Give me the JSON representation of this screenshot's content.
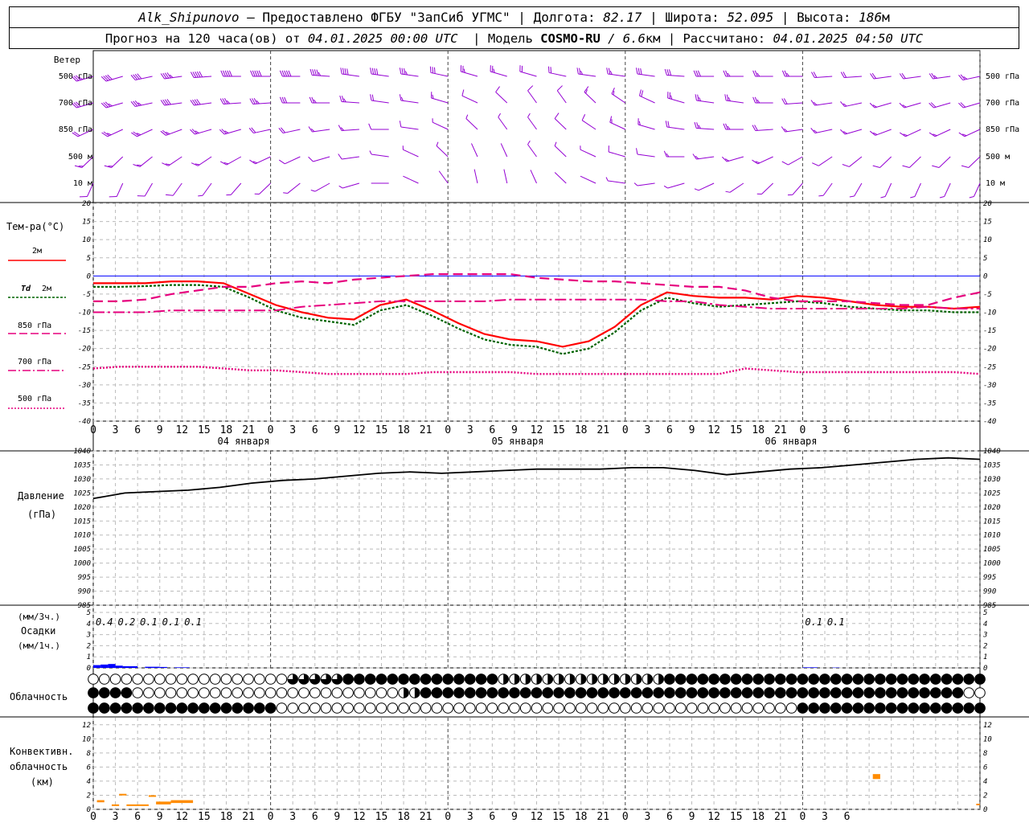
{
  "header": {
    "station": "Alk_Shipunovo",
    "provider": " – Предоставлено ФГБУ \"ЗапСиб УГМС\" | Долгота: ",
    "lon": "82.17",
    "lat_label": " | Широта: ",
    "lat": "52.095",
    "alt_label": " | Высота: ",
    "alt": "186",
    "alt_unit": "м",
    "forecast_prefix": "Прогноз на 120 часа(ов) от ",
    "forecast_start": "04.01.2025 00:00 UTC",
    "model_label": "  | Модель ",
    "model_name": "COSMO-RU",
    "model_res": " / 6.6",
    "model_res_unit": "км",
    "calc_label": " | Рассчитано: ",
    "calc_time": "04.01.2025 04:50 UTC"
  },
  "labels": {
    "wind": "Ветер",
    "wind_levels": [
      "500 гПа",
      "700 гПа",
      "850 гПа",
      "500 м",
      "10 м"
    ],
    "temp": "Тем-ра(°C)",
    "leg_2m": "2м",
    "leg_td": "Td",
    "leg_td2": "2м",
    "leg_850": "850 гПа",
    "leg_700": "700 гПа",
    "leg_500": "500 гПа",
    "pressure1": "Давление",
    "pressure2": "(гПа)",
    "precip1": "(мм/3ч.)",
    "precip2": "Осадки",
    "precip3": "(мм/1ч.)",
    "cloud": "Облачность",
    "conv1": "Конвективн.",
    "conv2": "облачность",
    "conv3": "(км)",
    "days": [
      "04 января",
      "05 января",
      "06 января"
    ]
  },
  "colors": {
    "wind": "#9400d3",
    "t2m": "#ff0000",
    "td2m": "#006400",
    "t850": "#e6007e",
    "t700": "#e6007e",
    "t500": "#e6007e",
    "pressure": "#000000",
    "precip": "#0000ff",
    "conv": "#ff8c00",
    "zero": "#0000ff"
  },
  "chart_data": [
    {
      "type": "line",
      "name": "temperature",
      "x_hours": [
        0,
        3,
        6,
        9,
        12,
        15,
        18,
        21,
        24,
        27,
        30,
        33,
        36,
        39,
        42,
        45,
        48,
        51,
        54,
        57,
        60,
        63,
        66,
        69,
        72,
        75,
        78,
        81,
        84,
        87,
        90,
        93,
        96,
        99,
        102,
        105,
        108,
        111,
        114,
        117,
        120
      ],
      "tick_labels": [
        "0",
        "3",
        "6",
        "9",
        "12",
        "15",
        "18",
        "21",
        "0",
        "3",
        "6",
        "9",
        "12",
        "15",
        "18",
        "21",
        "0",
        "3",
        "6",
        "9",
        "12",
        "15",
        "18",
        "21",
        "0",
        "3",
        "6",
        "9",
        "12",
        "15",
        "18",
        "21",
        "0",
        "3",
        "6"
      ],
      "ylim": [
        -40,
        20
      ],
      "yticks": [
        20,
        15,
        10,
        5,
        0,
        -5,
        -10,
        -15,
        -20,
        -25,
        -30,
        -35,
        -40
      ],
      "series": [
        {
          "name": "2м",
          "values": [
            -2,
            -2,
            -2,
            -1.5,
            -1.5,
            -2,
            -5,
            -8,
            -10,
            -11.5,
            -12,
            -8,
            -6.5,
            -9.5,
            -13,
            -16,
            -17.5,
            -18,
            -19.5,
            -18,
            -14,
            -8,
            -4.5,
            -5.5,
            -6,
            -6,
            -6.5,
            -5.5,
            -6,
            -7,
            -8,
            -8.5,
            -8.5,
            -9,
            -8.5
          ]
        },
        {
          "name": "Td 2м",
          "values": [
            -3,
            -3,
            -2.8,
            -2.5,
            -2.5,
            -3,
            -6,
            -9.5,
            -11.5,
            -12.5,
            -13.5,
            -9.5,
            -8,
            -11,
            -14.5,
            -17.5,
            -19,
            -19.5,
            -21.5,
            -20,
            -15.5,
            -9.5,
            -6,
            -7.5,
            -8.5,
            -8,
            -7.5,
            -7,
            -7.5,
            -8.5,
            -9,
            -9.5,
            -9.5,
            -10,
            -10
          ]
        },
        {
          "name": "850 гПа",
          "values": [
            -7,
            -7,
            -6.5,
            -5,
            -4,
            -3,
            -3,
            -2,
            -1.5,
            -2,
            -1,
            -0.5,
            0,
            0.5,
            0.5,
            0.5,
            0.5,
            -0.5,
            -1,
            -1.5,
            -1.5,
            -2,
            -2.5,
            -3,
            -3,
            -4,
            -6,
            -7,
            -7,
            -7,
            -7.5,
            -8,
            -8,
            -6,
            -4.5
          ]
        },
        {
          "name": "700 гПа",
          "values": [
            -10,
            -10,
            -10,
            -9.5,
            -9.5,
            -9.5,
            -9.5,
            -9.5,
            -8.5,
            -8,
            -7.5,
            -7,
            -7,
            -7,
            -7,
            -7,
            -6.5,
            -6.5,
            -6.5,
            -6.5,
            -6.5,
            -6.5,
            -7,
            -7,
            -8,
            -8.5,
            -9,
            -9,
            -9,
            -9,
            -9,
            -9,
            -8.5,
            -9,
            -9
          ]
        },
        {
          "name": "500 гПа",
          "values": [
            -25.5,
            -25,
            -25,
            -25,
            -25,
            -25.5,
            -26,
            -26,
            -26.5,
            -27,
            -27,
            -27,
            -27,
            -26.5,
            -26.5,
            -26.5,
            -26.5,
            -27,
            -27,
            -27,
            -27,
            -27,
            -27,
            -27,
            -27,
            -25.5,
            -26,
            -26.5,
            -26.5,
            -26.5,
            -26.5,
            -26.5,
            -26.5,
            -26.5,
            -27
          ]
        }
      ]
    },
    {
      "type": "line",
      "name": "pressure",
      "ylim": [
        985,
        1040
      ],
      "yticks": [
        1040,
        1035,
        1030,
        1025,
        1020,
        1015,
        1010,
        1005,
        1000,
        995,
        990,
        985
      ],
      "series": [
        {
          "name": "pressure",
          "values": [
            1023,
            1025,
            1025.5,
            1026,
            1027,
            1028.5,
            1029.5,
            1030,
            1031,
            1032,
            1032.5,
            1032,
            1032.5,
            1033,
            1033.5,
            1033.5,
            1033.5,
            1034,
            1034,
            1033,
            1031.5,
            1032.5,
            1033.5,
            1034,
            1035,
            1036,
            1037,
            1037.5,
            1037
          ]
        }
      ]
    },
    {
      "type": "bar",
      "name": "precipitation",
      "ylim": [
        0,
        5
      ],
      "yticks": [
        5,
        4,
        3,
        2,
        1,
        0
      ],
      "labels": [
        {
          "hour": 3,
          "text": "0.4"
        },
        {
          "hour": 6,
          "text": "0.2"
        },
        {
          "hour": 9,
          "text": "0.1"
        },
        {
          "hour": 12,
          "text": "0.1"
        },
        {
          "hour": 15,
          "text": "0.1"
        },
        {
          "hour": 99,
          "text": "0.1"
        },
        {
          "hour": 102,
          "text": "0.1"
        }
      ],
      "bars": [
        {
          "hour": 1,
          "value": 0.25
        },
        {
          "hour": 2,
          "value": 0.3
        },
        {
          "hour": 3,
          "value": 0.35
        },
        {
          "hour": 4,
          "value": 0.2
        },
        {
          "hour": 5,
          "value": 0.15
        },
        {
          "hour": 6,
          "value": 0.15
        },
        {
          "hour": 8,
          "value": 0.1
        },
        {
          "hour": 9,
          "value": 0.1
        },
        {
          "hour": 10,
          "value": 0.08
        },
        {
          "hour": 12,
          "value": 0.05
        },
        {
          "hour": 13,
          "value": 0.05
        },
        {
          "hour": 97,
          "value": 0.05
        },
        {
          "hour": 98,
          "value": 0.05
        },
        {
          "hour": 101,
          "value": 0.03
        }
      ]
    },
    {
      "type": "heatmap",
      "name": "cloud_cover",
      "rows": [
        "000000000000000000333334444444444444422222222222222244444444444444444444444444444",
        "444400000000000000000000000022444444444444444444444444444444444444444444444444400",
        "444444444444444440000000000000000000000000000000000000000000000044444444444444444"
      ]
    },
    {
      "type": "bar",
      "name": "convective_cloud",
      "ylim": [
        0,
        13
      ],
      "yticks": [
        12,
        10,
        8,
        6,
        4,
        2,
        0
      ],
      "segments": [
        {
          "h0": 0.5,
          "h1": 1.5,
          "base": 1.0,
          "top": 1.3
        },
        {
          "h0": 2.5,
          "h1": 3.5,
          "base": 0.6,
          "top": 0.7
        },
        {
          "h0": 3.5,
          "h1": 4.5,
          "base": 2.0,
          "top": 2.2
        },
        {
          "h0": 4.5,
          "h1": 7.5,
          "base": 0.6,
          "top": 0.7
        },
        {
          "h0": 7.5,
          "h1": 8.5,
          "base": 1.8,
          "top": 2.0
        },
        {
          "h0": 8.5,
          "h1": 10.5,
          "base": 0.7,
          "top": 1.1
        },
        {
          "h0": 10.5,
          "h1": 13.5,
          "base": 0.9,
          "top": 1.3
        },
        {
          "h0": 105.5,
          "h1": 106.5,
          "base": 4.3,
          "top": 5.0
        },
        {
          "h0": 119.5,
          "h1": 121.5,
          "base": 0.6,
          "top": 0.8
        }
      ]
    },
    {
      "type": "scatter",
      "name": "wind_barbs",
      "levels": [
        "500 гПа",
        "700 гПа",
        "850 гПа",
        "500 м",
        "10 м"
      ],
      "direction_deg": [
        [
          250,
          250,
          255,
          260,
          265,
          270,
          270,
          270,
          275,
          280,
          280,
          280,
          285,
          290,
          290,
          290,
          285,
          280,
          280,
          280,
          275,
          270,
          270,
          270,
          270,
          265,
          265,
          260,
          260,
          260,
          255
        ],
        [
          250,
          250,
          255,
          260,
          260,
          265,
          265,
          270,
          270,
          275,
          280,
          280,
          290,
          300,
          320,
          330,
          330,
          320,
          310,
          300,
          290,
          280,
          280,
          270,
          265,
          260,
          255,
          250,
          250,
          250,
          250
        ],
        [
          240,
          240,
          240,
          245,
          250,
          250,
          255,
          255,
          260,
          265,
          270,
          280,
          300,
          320,
          330,
          330,
          320,
          310,
          300,
          290,
          280,
          275,
          270,
          265,
          260,
          255,
          250,
          245,
          240,
          240,
          240
        ],
        [
          220,
          220,
          225,
          230,
          230,
          235,
          240,
          240,
          250,
          260,
          280,
          300,
          320,
          340,
          340,
          330,
          320,
          300,
          290,
          280,
          270,
          260,
          250,
          240,
          235,
          230,
          225,
          220,
          220,
          220,
          220
        ],
        [
          200,
          200,
          205,
          210,
          210,
          215,
          220,
          225,
          235,
          250,
          270,
          300,
          330,
          350,
          350,
          340,
          320,
          300,
          280,
          260,
          250,
          240,
          230,
          220,
          215,
          210,
          205,
          200,
          200,
          200,
          200
        ]
      ],
      "speed_ms": [
        [
          30,
          32,
          35,
          38,
          40,
          42,
          42,
          40,
          38,
          35,
          32,
          30,
          25,
          22,
          20,
          18,
          18,
          20,
          22,
          25,
          25,
          25,
          22,
          20,
          20,
          18,
          18,
          18,
          18,
          20,
          20
        ],
        [
          25,
          28,
          30,
          32,
          32,
          30,
          28,
          25,
          22,
          20,
          18,
          15,
          12,
          10,
          8,
          8,
          10,
          12,
          15,
          18,
          20,
          22,
          22,
          20,
          18,
          15,
          15,
          15,
          15,
          18,
          18
        ],
        [
          18,
          20,
          22,
          22,
          22,
          20,
          18,
          18,
          15,
          12,
          10,
          8,
          6,
          5,
          5,
          6,
          8,
          10,
          12,
          15,
          18,
          20,
          20,
          18,
          15,
          12,
          12,
          12,
          12,
          12,
          12
        ],
        [
          15,
          15,
          15,
          15,
          12,
          12,
          12,
          10,
          10,
          8,
          6,
          5,
          4,
          3,
          3,
          4,
          5,
          6,
          8,
          10,
          12,
          12,
          12,
          12,
          10,
          10,
          8,
          8,
          8,
          8,
          8
        ],
        [
          8,
          8,
          8,
          8,
          6,
          6,
          6,
          5,
          5,
          4,
          3,
          3,
          2,
          2,
          2,
          2,
          3,
          3,
          4,
          5,
          6,
          6,
          6,
          6,
          5,
          5,
          4,
          4,
          4,
          4,
          4
        ]
      ]
    }
  ]
}
